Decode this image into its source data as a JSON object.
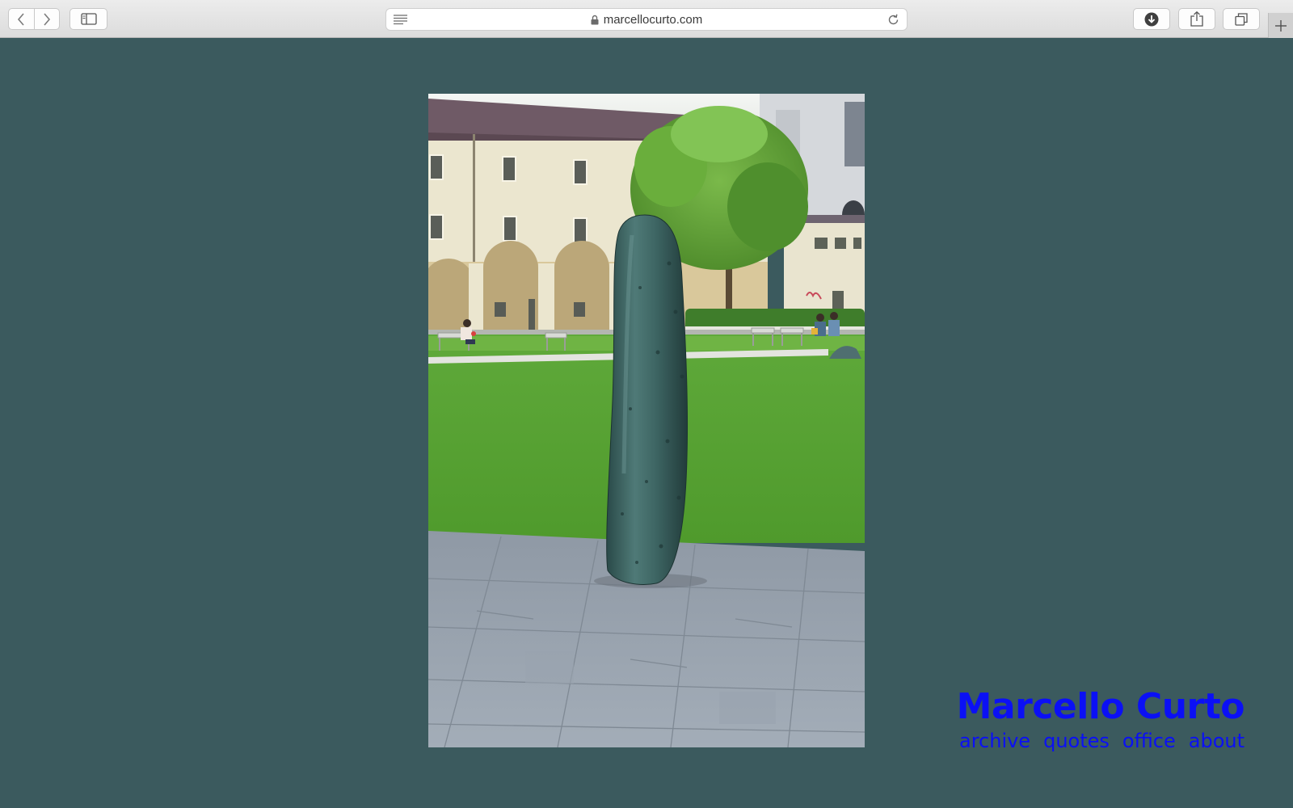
{
  "browser": {
    "url": "marcellocurto.com",
    "icons": {
      "back": "chevron-left-icon",
      "forward": "chevron-right-icon",
      "sidebar": "sidebar-icon",
      "reader": "reader-icon",
      "lock": "lock-icon",
      "reload": "reload-icon",
      "downloads": "download-icon",
      "share": "share-icon",
      "tabs": "tabs-icon",
      "new_tab": "plus-icon"
    }
  },
  "page": {
    "background_color": "#3b5a5e",
    "accent_color": "#0b10f5",
    "photo": {
      "subject": "cucumber sculpture on a paved plaza in front of a courtyard lawn"
    },
    "site_title": "Marcello Curto",
    "nav": [
      {
        "label": "archive"
      },
      {
        "label": "quotes"
      },
      {
        "label": "office"
      },
      {
        "label": "about"
      }
    ]
  }
}
